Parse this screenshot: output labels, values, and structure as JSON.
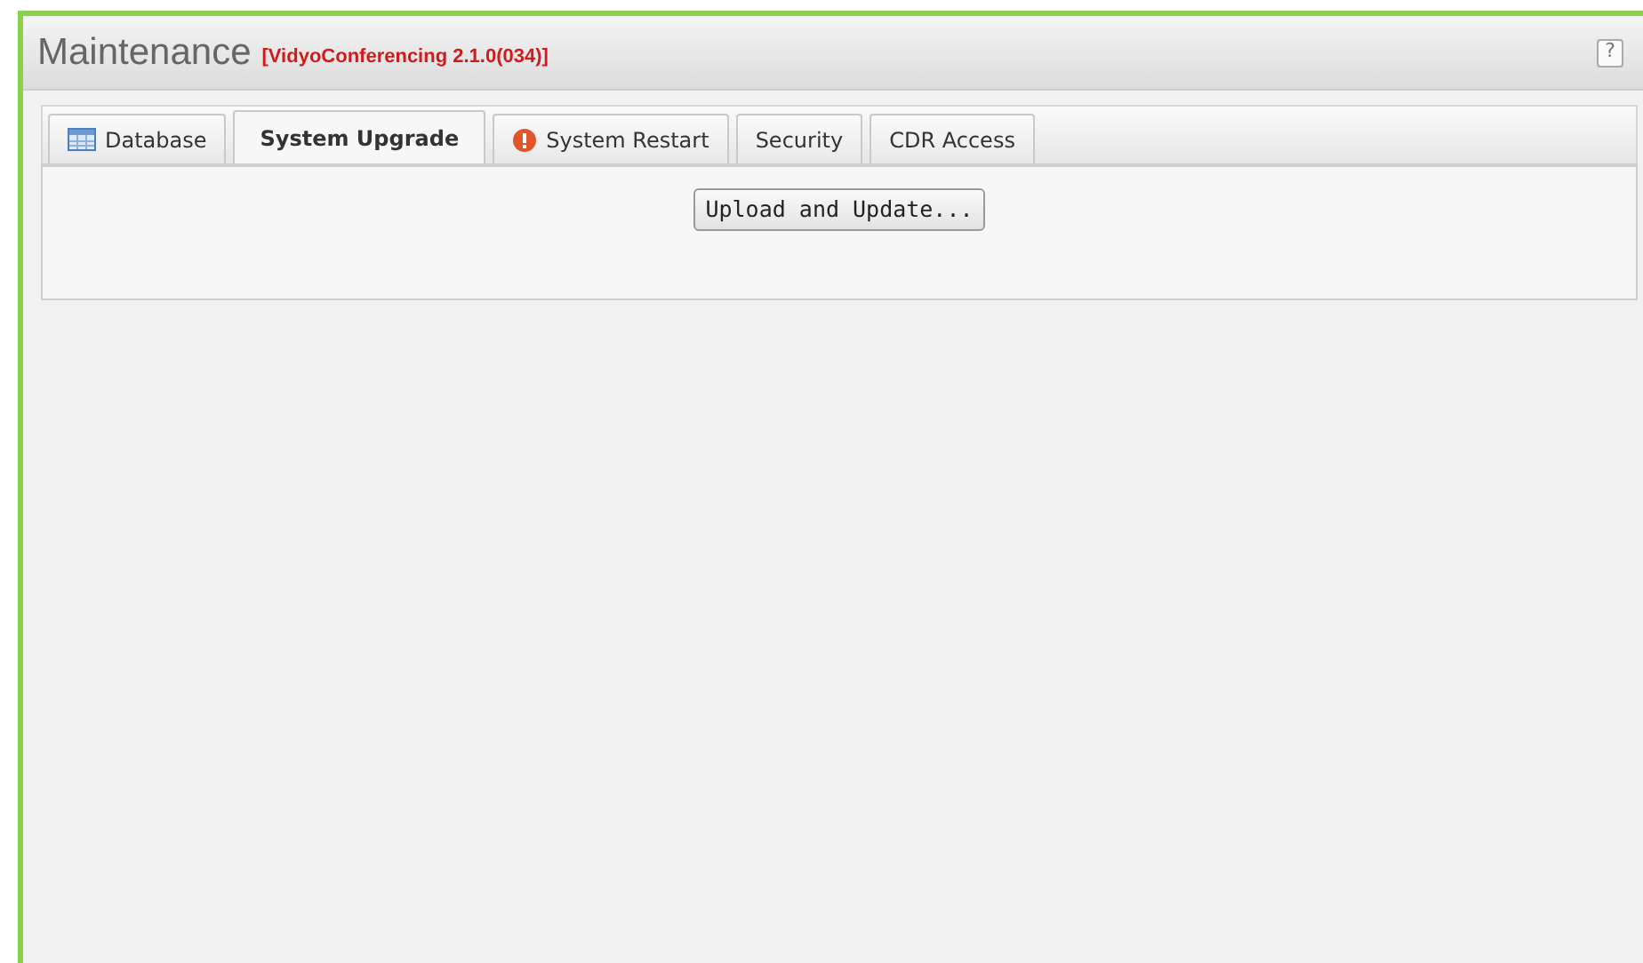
{
  "header": {
    "title": "Maintenance",
    "version": "[VidyoConferencing 2.1.0(034)]",
    "help": "?"
  },
  "tabs": [
    {
      "label": "Database",
      "kind": "table",
      "selected": false
    },
    {
      "label": "System Upgrade",
      "kind": "plain",
      "selected": true
    },
    {
      "label": "System Restart",
      "kind": "alert",
      "selected": false
    },
    {
      "label": "Security",
      "kind": "plain",
      "selected": false
    },
    {
      "label": "CDR Access",
      "kind": "plain",
      "selected": false
    }
  ],
  "panel": {
    "button": "Upload and Update..."
  }
}
